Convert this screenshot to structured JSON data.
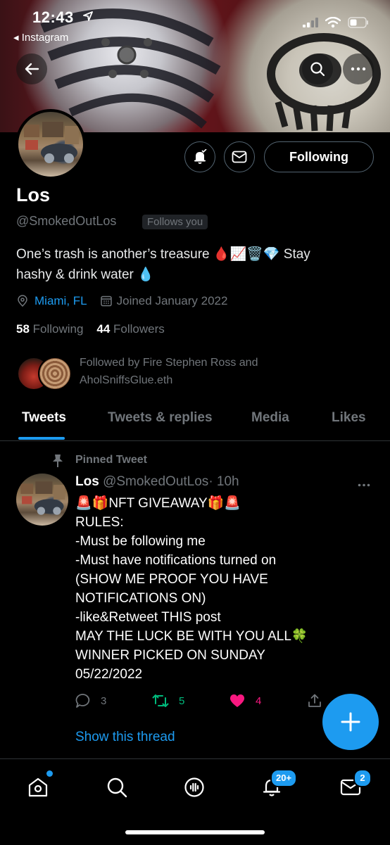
{
  "status_bar": {
    "time": "12:43",
    "back_app": "Instagram"
  },
  "profile": {
    "name": "Los",
    "handle": "@SmokedOutLos",
    "follows_you": "Follows you",
    "bio_line1": "One’s trash is another’s treasure 🩸📈🗑️💎 Stay",
    "bio_line2": "hashy & drink water 💧",
    "location": "Miami, FL",
    "joined": "Joined January 2022",
    "following_count": "58",
    "following_label": "Following",
    "followers_count": "44",
    "followers_label": "Followers",
    "followed_by_line1": "Followed by Fire Stephen Ross and",
    "followed_by_line2": "AholSniffsGlue.eth",
    "following_button": "Following"
  },
  "tabs": [
    {
      "label": "Tweets",
      "active": true
    },
    {
      "label": "Tweets & replies",
      "active": false
    },
    {
      "label": "Media",
      "active": false
    },
    {
      "label": "Likes",
      "active": false
    }
  ],
  "tweet": {
    "pinned_label": "Pinned Tweet",
    "author": "Los",
    "handle": "@SmokedOutLos",
    "time": "· 10h",
    "lines": [
      "🚨🎁NFT GIVEAWAY🎁🚨",
      "RULES:",
      "-Must be following me",
      "-Must have notifications turned on",
      "(SHOW ME PROOF YOU HAVE",
      "NOTIFICATIONS ON)",
      "-like&Retweet THIS post",
      "MAY THE LUCK BE WITH YOU ALL🍀",
      "WINNER PICKED ON SUNDAY",
      "05/22/2022"
    ],
    "replies": "3",
    "retweets": "5",
    "likes": "4",
    "show_thread": "Show this thread"
  },
  "bottom_nav": {
    "notifications_badge": "20+",
    "messages_badge": "2"
  },
  "colors": {
    "accent": "#1d9bf0",
    "like": "#f91880",
    "retweet": "#00ba7c",
    "muted": "#71767b"
  }
}
